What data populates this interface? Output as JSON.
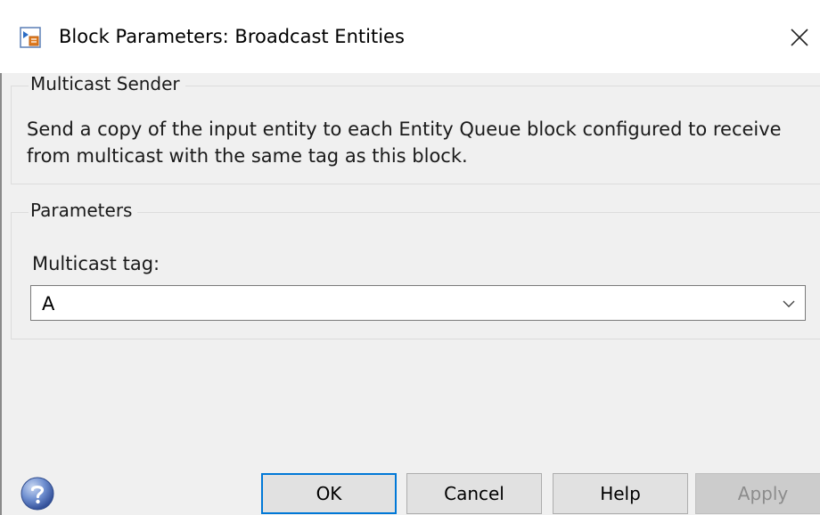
{
  "window": {
    "title": "Block Parameters: Broadcast Entities",
    "close_glyph": "✕",
    "icon": "simulink-block-icon"
  },
  "multicast_group": {
    "title": "Multicast Sender",
    "description": "Send a copy of the input entity to each Entity Queue block configured to receive from multicast with the same tag as this block."
  },
  "parameters_group": {
    "title": "Parameters",
    "multicast_tag_label": "Multicast tag:",
    "multicast_tag_value": "A"
  },
  "buttons": {
    "ok": "OK",
    "cancel": "Cancel",
    "help": "Help",
    "apply": "Apply"
  },
  "colors": {
    "accent": "#0078d7",
    "disabled_text": "#8c8c8c"
  }
}
